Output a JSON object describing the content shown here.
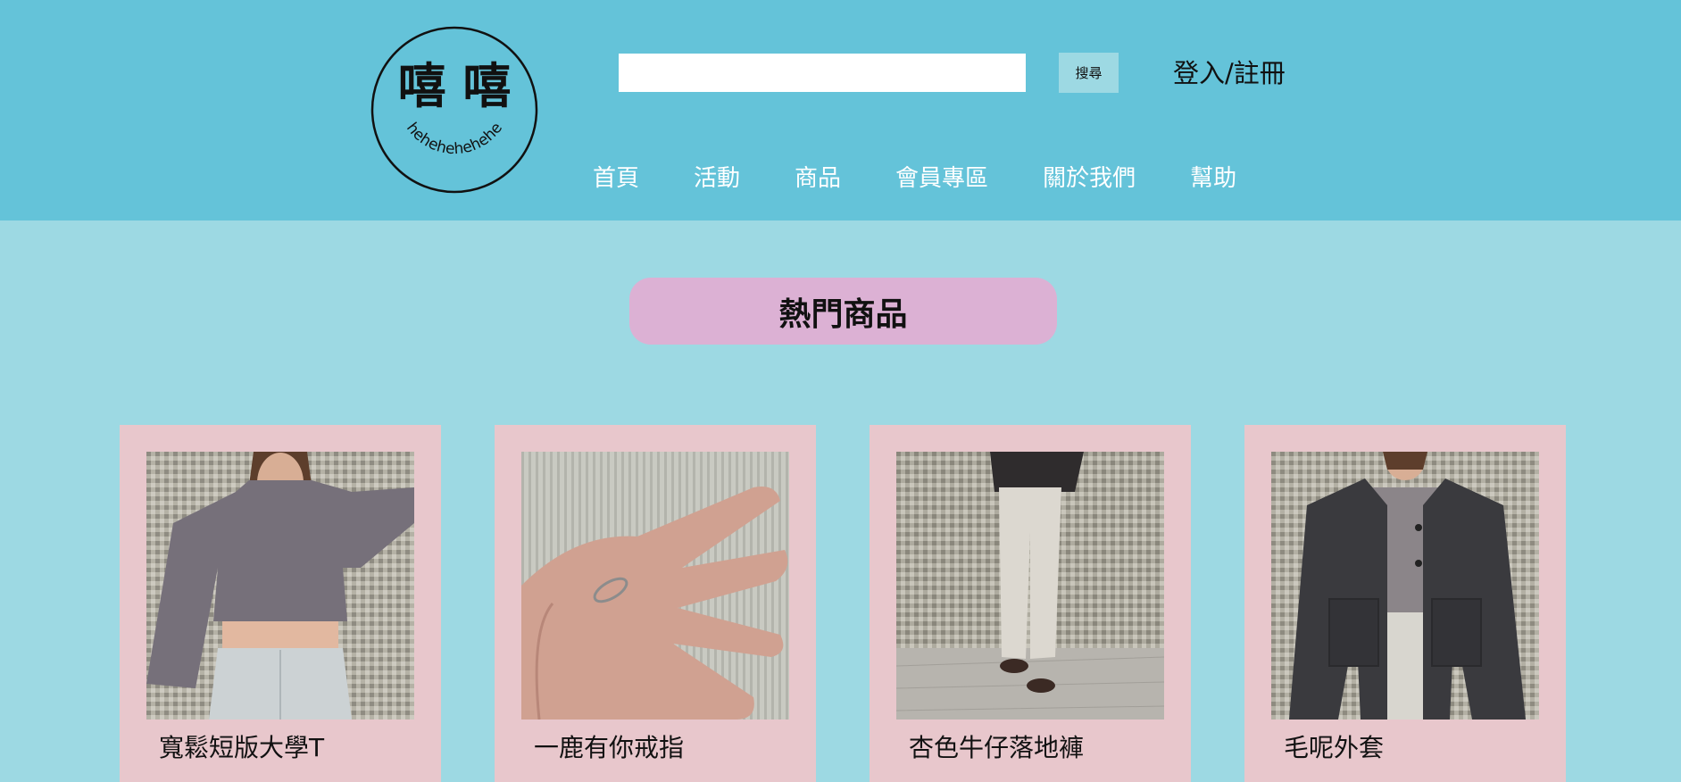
{
  "header": {
    "logo": {
      "title": "嘻 嘻",
      "tagline": "hehehehehehe"
    },
    "search": {
      "value": "",
      "placeholder": "",
      "button_label": "搜尋"
    },
    "login_label": "登入/註冊",
    "nav": [
      {
        "label": "首頁"
      },
      {
        "label": "活動"
      },
      {
        "label": "商品"
      },
      {
        "label": "會員專區"
      },
      {
        "label": "關於我們"
      },
      {
        "label": "幫助"
      }
    ]
  },
  "main": {
    "section_title": "熱門商品",
    "products": [
      {
        "name": "寬鬆短版大學T",
        "image": "gray-cropped-sweatshirt-photo"
      },
      {
        "name": "一鹿有你戒指",
        "image": "ring-on-hand-photo"
      },
      {
        "name": "杏色牛仔落地褲",
        "image": "beige-wide-leg-jeans-photo"
      },
      {
        "name": "毛呢外套",
        "image": "wool-jacket-photo"
      }
    ]
  },
  "colors": {
    "header_bg": "#64c3d9",
    "page_bg": "#9dd9e3",
    "pill_bg": "#dcb1d4",
    "card_bg": "#e8c7cc"
  }
}
